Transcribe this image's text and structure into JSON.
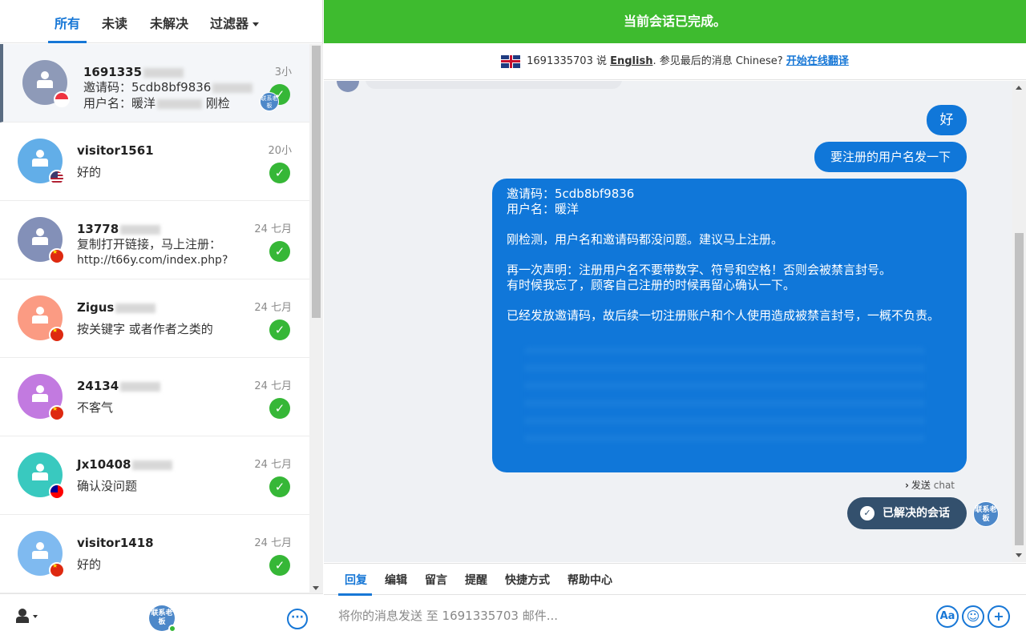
{
  "tabs": [
    {
      "label": "所有"
    },
    {
      "label": "未读"
    },
    {
      "label": "未解决"
    },
    {
      "label": "过滤器"
    }
  ],
  "conversations": [
    {
      "name": "1691335",
      "time": "3小",
      "line1": "邀请码：5cdb8bf9836",
      "line2": "用户名：暖洋",
      "line2_tail": "刚检",
      "badge": "联系老板",
      "avatar_color": "#8e9ab8",
      "flag": "sg"
    },
    {
      "name": "visitor1561",
      "time": "20小",
      "msg": "好的",
      "avatar_color": "#62aee8",
      "flag": "us"
    },
    {
      "name": "13778",
      "time": "24 七月",
      "msg": "复制打开链接，马上注册：",
      "msg2": "http://t66y.com/index.php?",
      "avatar_color": "#8390b8",
      "flag": "cn"
    },
    {
      "name": "Zigus",
      "time": "24 七月",
      "msg": "按关键字 或者作者之类的",
      "avatar_color": "#fb9b83",
      "flag": "cn"
    },
    {
      "name": "24134",
      "time": "24 七月",
      "msg": "不客气",
      "avatar_color": "#c27ae0",
      "flag": "cn"
    },
    {
      "name": "Jx10408",
      "time": "24 七月",
      "msg": "确认没问题",
      "avatar_color": "#39c9bf",
      "flag": "tw"
    },
    {
      "name": "visitor1418",
      "time": "24 七月",
      "msg": "好的",
      "avatar_color": "#7fbaf0",
      "flag": "cn"
    }
  ],
  "footer": {
    "avatar_label": "联系老板"
  },
  "banner": "当前会话已完成。",
  "translate": {
    "visitor": "1691335703 说",
    "language": "English",
    "middle": ". 参见最后的消息 Chinese?",
    "link": "开始在线翻译"
  },
  "messages": {
    "m1": "好",
    "m2": "要注册的用户名发一下",
    "m3": "邀请码：5cdb8bf9836\n用户名：暖洋\n\n刚检测，用户名和邀请码都没问题。建议马上注册。\n\n再一次声明：注册用户名不要带数字、符号和空格！否则会被禁言封号。\n有时候我忘了，顾客自己注册的时候再留心确认一下。\n\n已经发放邀请码，故后续一切注册账户和个人使用造成被禁言封号，一概不负责。",
    "status_prefix": "发送",
    "status_suffix": "chat",
    "resolved": "已解决的会话",
    "agent_label": "联系老板"
  },
  "composer": {
    "tabs": [
      "回复",
      "编辑",
      "留言",
      "提醒",
      "快捷方式",
      "帮助中心"
    ],
    "placeholder": "将你的消息发送 至 1691335703 邮件...",
    "font_btn": "Aa",
    "emoji_btn": "☺",
    "add_btn": "+"
  },
  "accent": "#1777d6",
  "success": "#3ebb2f"
}
